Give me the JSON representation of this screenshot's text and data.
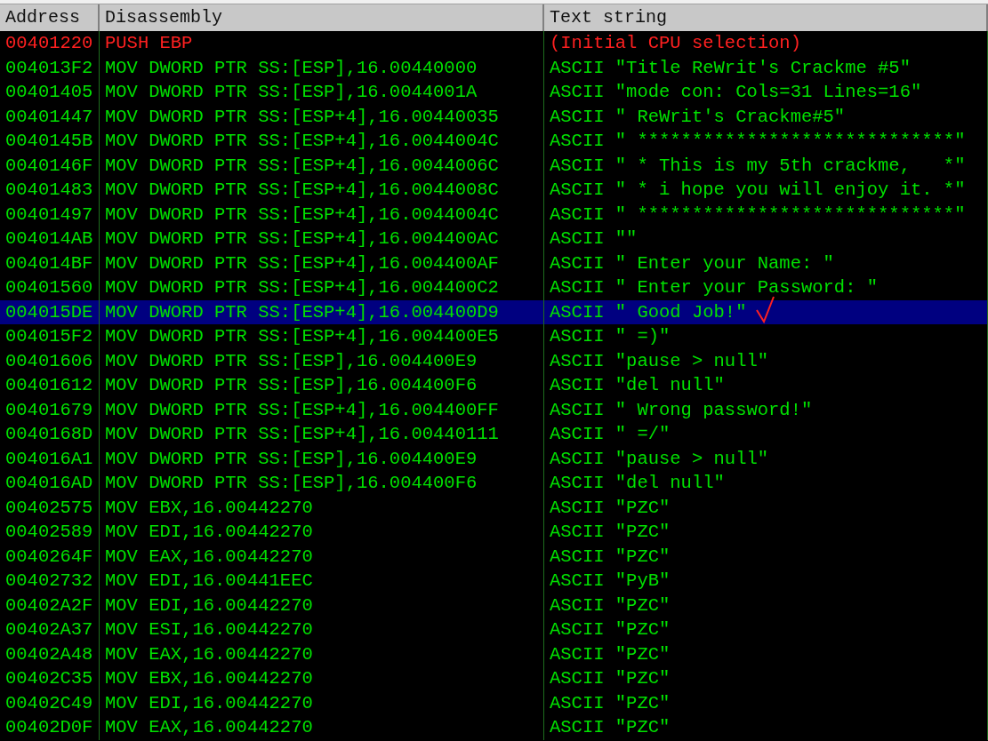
{
  "table": {
    "columns": [
      "Address",
      "Disassembly",
      "Text string"
    ],
    "rows": [
      {
        "address": "00401220",
        "disassembly": "PUSH EBP",
        "text": "(Initial CPU selection)",
        "kind": "initial",
        "selected": false,
        "checkmark": false
      },
      {
        "address": "004013F2",
        "disassembly": "MOV DWORD PTR SS:[ESP],16.00440000",
        "text": "ASCII \"Title ReWrit's Crackme #5\"",
        "kind": "string",
        "selected": false,
        "checkmark": false
      },
      {
        "address": "00401405",
        "disassembly": "MOV DWORD PTR SS:[ESP],16.0044001A",
        "text": "ASCII \"mode con: Cols=31 Lines=16\"",
        "kind": "string",
        "selected": false,
        "checkmark": false
      },
      {
        "address": "00401447",
        "disassembly": "MOV DWORD PTR SS:[ESP+4],16.00440035",
        "text": "ASCII \" ReWrit's Crackme#5\"",
        "kind": "string",
        "selected": false,
        "checkmark": false
      },
      {
        "address": "0040145B",
        "disassembly": "MOV DWORD PTR SS:[ESP+4],16.0044004C",
        "text": "ASCII \" *****************************\"",
        "kind": "string",
        "selected": false,
        "checkmark": false
      },
      {
        "address": "0040146F",
        "disassembly": "MOV DWORD PTR SS:[ESP+4],16.0044006C",
        "text": "ASCII \" * This is my 5th crackme,   *\"",
        "kind": "string",
        "selected": false,
        "checkmark": false
      },
      {
        "address": "00401483",
        "disassembly": "MOV DWORD PTR SS:[ESP+4],16.0044008C",
        "text": "ASCII \" * i hope you will enjoy it. *\"",
        "kind": "string",
        "selected": false,
        "checkmark": false
      },
      {
        "address": "00401497",
        "disassembly": "MOV DWORD PTR SS:[ESP+4],16.0044004C",
        "text": "ASCII \" *****************************\"",
        "kind": "string",
        "selected": false,
        "checkmark": false
      },
      {
        "address": "004014AB",
        "disassembly": "MOV DWORD PTR SS:[ESP+4],16.004400AC",
        "text": "ASCII \"\"",
        "kind": "string",
        "selected": false,
        "checkmark": false
      },
      {
        "address": "004014BF",
        "disassembly": "MOV DWORD PTR SS:[ESP+4],16.004400AF",
        "text": "ASCII \" Enter your Name: \"",
        "kind": "string",
        "selected": false,
        "checkmark": false
      },
      {
        "address": "00401560",
        "disassembly": "MOV DWORD PTR SS:[ESP+4],16.004400C2",
        "text": "ASCII \" Enter your Password: \"",
        "kind": "string",
        "selected": false,
        "checkmark": false
      },
      {
        "address": "004015DE",
        "disassembly": "MOV DWORD PTR SS:[ESP+4],16.004400D9",
        "text": "ASCII \" Good Job!\"",
        "kind": "string",
        "selected": true,
        "checkmark": true
      },
      {
        "address": "004015F2",
        "disassembly": "MOV DWORD PTR SS:[ESP+4],16.004400E5",
        "text": "ASCII \" =)\"",
        "kind": "string",
        "selected": false,
        "checkmark": false
      },
      {
        "address": "00401606",
        "disassembly": "MOV DWORD PTR SS:[ESP],16.004400E9",
        "text": "ASCII \"pause > null\"",
        "kind": "string",
        "selected": false,
        "checkmark": false
      },
      {
        "address": "00401612",
        "disassembly": "MOV DWORD PTR SS:[ESP],16.004400F6",
        "text": "ASCII \"del null\"",
        "kind": "string",
        "selected": false,
        "checkmark": false
      },
      {
        "address": "00401679",
        "disassembly": "MOV DWORD PTR SS:[ESP+4],16.004400FF",
        "text": "ASCII \" Wrong password!\"",
        "kind": "string",
        "selected": false,
        "checkmark": false
      },
      {
        "address": "0040168D",
        "disassembly": "MOV DWORD PTR SS:[ESP+4],16.00440111",
        "text": "ASCII \" =/\"",
        "kind": "string",
        "selected": false,
        "checkmark": false
      },
      {
        "address": "004016A1",
        "disassembly": "MOV DWORD PTR SS:[ESP],16.004400E9",
        "text": "ASCII \"pause > null\"",
        "kind": "string",
        "selected": false,
        "checkmark": false
      },
      {
        "address": "004016AD",
        "disassembly": "MOV DWORD PTR SS:[ESP],16.004400F6",
        "text": "ASCII \"del null\"",
        "kind": "string",
        "selected": false,
        "checkmark": false
      },
      {
        "address": "00402575",
        "disassembly": "MOV EBX,16.00442270",
        "text": "ASCII \"PZC\"",
        "kind": "string",
        "selected": false,
        "checkmark": false
      },
      {
        "address": "00402589",
        "disassembly": "MOV EDI,16.00442270",
        "text": "ASCII \"PZC\"",
        "kind": "string",
        "selected": false,
        "checkmark": false
      },
      {
        "address": "0040264F",
        "disassembly": "MOV EAX,16.00442270",
        "text": "ASCII \"PZC\"",
        "kind": "string",
        "selected": false,
        "checkmark": false
      },
      {
        "address": "00402732",
        "disassembly": "MOV EDI,16.00441EEC",
        "text": "ASCII \"PyB\"",
        "kind": "string",
        "selected": false,
        "checkmark": false
      },
      {
        "address": "00402A2F",
        "disassembly": "MOV EDI,16.00442270",
        "text": "ASCII \"PZC\"",
        "kind": "string",
        "selected": false,
        "checkmark": false
      },
      {
        "address": "00402A37",
        "disassembly": "MOV ESI,16.00442270",
        "text": "ASCII \"PZC\"",
        "kind": "string",
        "selected": false,
        "checkmark": false
      },
      {
        "address": "00402A48",
        "disassembly": "MOV EAX,16.00442270",
        "text": "ASCII \"PZC\"",
        "kind": "string",
        "selected": false,
        "checkmark": false
      },
      {
        "address": "00402C35",
        "disassembly": "MOV EBX,16.00442270",
        "text": "ASCII \"PZC\"",
        "kind": "string",
        "selected": false,
        "checkmark": false
      },
      {
        "address": "00402C49",
        "disassembly": "MOV EDI,16.00442270",
        "text": "ASCII \"PZC\"",
        "kind": "string",
        "selected": false,
        "checkmark": false
      },
      {
        "address": "00402D0F",
        "disassembly": "MOV EAX,16.00442270",
        "text": "ASCII \"PZC\"",
        "kind": "string",
        "selected": false,
        "checkmark": false
      }
    ]
  }
}
